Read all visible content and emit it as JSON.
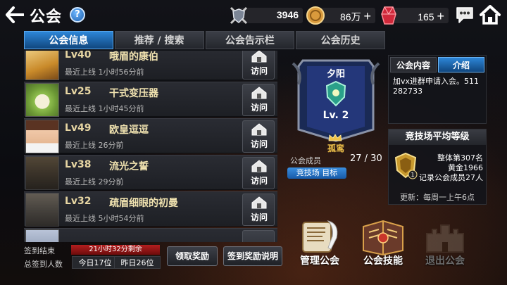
{
  "header": {
    "title": "公会",
    "help_glyph": "?",
    "resources": {
      "shield": "3946",
      "gold": "86万",
      "gem": "165"
    },
    "plus_glyph": "+"
  },
  "tabs": [
    {
      "label": "公会信息",
      "active": true
    },
    {
      "label": "推荐 / 搜索",
      "active": false
    },
    {
      "label": "公会告示栏",
      "active": false
    },
    {
      "label": "公会历史",
      "active": false
    }
  ],
  "members": [
    {
      "level": "Lv40",
      "name": "哦眉的康伯",
      "last_online": "最近上线 1小时56分前",
      "visit": "访问"
    },
    {
      "level": "Lv25",
      "name": "干式变压器",
      "last_online": "最近上线 1小时45分前",
      "visit": "访问"
    },
    {
      "level": "Lv49",
      "name": "欧皇逗逗",
      "last_online": "最近上线 26分前",
      "visit": "访问"
    },
    {
      "level": "Lv38",
      "name": "流光之誓",
      "last_online": "最近上线 29分前",
      "visit": "访问"
    },
    {
      "level": "Lv32",
      "name": "疏眉细眼的初曼",
      "last_online": "最近上线 5小时54分前",
      "visit": "访问"
    }
  ],
  "signin": {
    "end_label": "签到结束",
    "countdown": "21小时32分剩余",
    "total_label": "总签到人数",
    "today": "今日17位",
    "yesterday": "昨日26位",
    "claim_button": "领取奖励",
    "info_button": "签到奖励说明"
  },
  "guild": {
    "name": "夕阳",
    "level": "Lv. 2",
    "leader": "孤鸾",
    "members_label": "公会成员",
    "members_value": "27 / 30",
    "arena_target": "竞技场 目标"
  },
  "notice": {
    "tab_content": "公会内容",
    "tab_intro": "介绍",
    "text": "加vx进群申请入会。511282733"
  },
  "arena": {
    "title": "竞技场平均等级",
    "rank": "整体第307名",
    "tier": "黄金1966",
    "record": "记录公会成员27人",
    "update": "更新：每周一上午6点",
    "emblem_number": "1"
  },
  "actions": [
    {
      "label": "管理公会",
      "icon": "scroll-quill-icon",
      "enabled": true
    },
    {
      "label": "公会技能",
      "icon": "spellbook-icon",
      "enabled": true
    },
    {
      "label": "退出公会",
      "icon": "castle-icon",
      "enabled": false
    }
  ],
  "colors": {
    "tab_active": "#1f6fc0",
    "accent_gold": "#f0c24a",
    "timer_red": "#b41e1e"
  }
}
